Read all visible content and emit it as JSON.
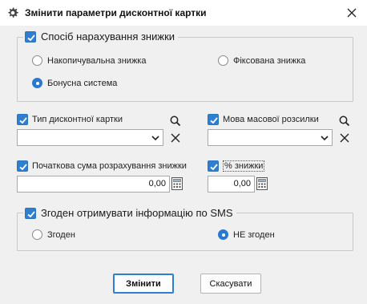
{
  "dialog": {
    "title": "Змінити параметри дисконтної картки",
    "title_icon": "gear-icon",
    "close_icon": "close-icon"
  },
  "discount_group": {
    "label": "Спосіб нарахування знижки",
    "checked": true,
    "options": [
      {
        "label": "Накопичувальна знижка",
        "selected": false
      },
      {
        "label": "Фіксована знижка",
        "selected": false
      },
      {
        "label": "Бонусна система",
        "selected": true
      }
    ]
  },
  "card_type": {
    "label": "Тип дисконтної картки",
    "checked": true,
    "value": "",
    "search_icon": "search-icon",
    "clear_icon": "clear-icon"
  },
  "mailing_language": {
    "label": "Мова масової розсилки",
    "checked": true,
    "value": "",
    "search_icon": "search-icon",
    "clear_icon": "clear-icon"
  },
  "initial_sum": {
    "label": "Початкова сума розрахування знижки",
    "checked": true,
    "value": "0,00",
    "calculator_icon": "calculator-icon"
  },
  "discount_percent": {
    "label": "% знижки",
    "checked": true,
    "value": "0,00",
    "calculator_icon": "calculator-icon"
  },
  "sms_group": {
    "label": "Згоден отримувати інформацію по SMS",
    "checked": true,
    "options": [
      {
        "label": "Згоден",
        "selected": false
      },
      {
        "label": "НЕ згоден",
        "selected": true
      }
    ]
  },
  "buttons": {
    "ok": "Змінити",
    "cancel": "Скасувати"
  },
  "colors": {
    "accent": "#2f7fd1",
    "background": "#f0f0f0",
    "titlebar": "#ffffff"
  }
}
